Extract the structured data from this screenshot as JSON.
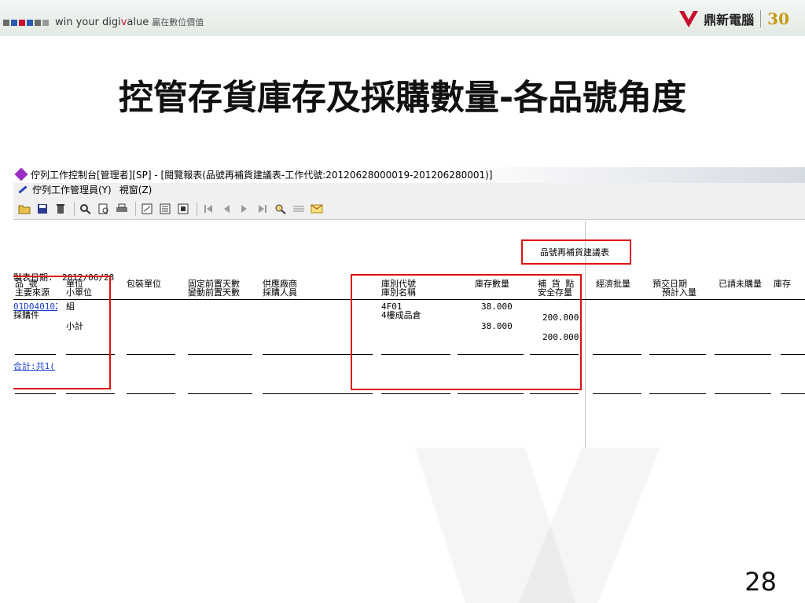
{
  "banner": {
    "square_colors": [
      "#6a6a6a",
      "#2a5bb0",
      "#c8102e",
      "#2a5bb0",
      "#6a6a6a",
      "#9a9a9a"
    ],
    "slogan_prefix": "win your digi",
    "slogan_v": "v",
    "slogan_suffix": "alue",
    "slogan_zh": "贏在數位價值",
    "brand_name": "鼎新電腦",
    "brand_30": "30"
  },
  "slide": {
    "title": "控管存貨庫存及採購數量-各品號角度",
    "page_number": "28"
  },
  "window": {
    "title": "佇列工作控制台[管理者][SP] - [閱覽報表(品號再補貨建議表-工作代號:20120628000019-201206280001)]",
    "menu": {
      "manager": "佇列工作管理員(Y)",
      "window": "視窗(Z)"
    },
    "toolbar_icons": [
      "open-icon",
      "save-icon",
      "delete-icon",
      "find-icon",
      "preview-icon",
      "print-icon",
      "export-icon",
      "copy-icon",
      "paste-icon",
      "first-page-icon",
      "prev-page-icon",
      "next-page-icon",
      "last-page-icon",
      "zoom-icon",
      "lines-icon",
      "mail-icon"
    ]
  },
  "report": {
    "report_title": "品號再補貨建議表",
    "date_label": "製表日期:",
    "date_value": "2012/06/28",
    "headers": {
      "item_no": "品    號",
      "main_source": "主要來源",
      "unit": "單位",
      "sub_unit": "小單位",
      "pack_unit": "包裝單位",
      "fixed_lead": "固定前置天數",
      "var_lead": "變動前置天數",
      "supplier": "供應廠商",
      "buyer": "採購人員",
      "wh_code": "庫別代號",
      "wh_name": "庫別名稱",
      "stock_qty": "庫存數量",
      "reorder_point": "補 貨 點",
      "safety_stock": "安全存量",
      "eco_lot": "經濟批量",
      "due_date": "預交日期",
      "expected_in": "預計入量",
      "requested_unbought": "已請未購量",
      "wh_cut": "庫存"
    },
    "row": {
      "item_no": "01D040102",
      "source": "採購件",
      "unit": "組",
      "subtotal_label": "小計",
      "wh_code": "4F01",
      "wh_name": "4樓成品倉",
      "stock_qty": "38.000",
      "subtotal_stock": "38.000",
      "reorder_point": "200.000",
      "subtotal_reorder": "200.000"
    },
    "total_label": "合計:共1("
  }
}
